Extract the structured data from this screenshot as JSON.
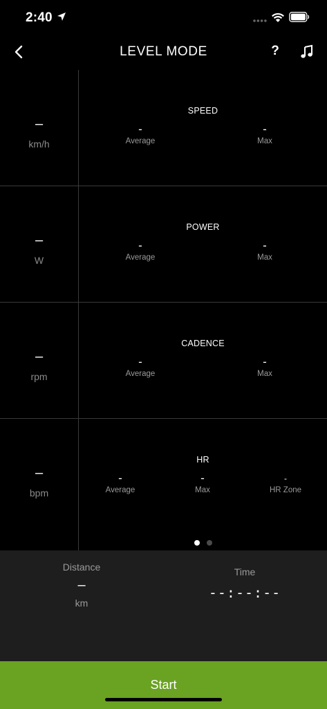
{
  "status_bar": {
    "time": "2:40"
  },
  "nav": {
    "title": "LEVEL MODE",
    "help": "?"
  },
  "metrics": {
    "speed": {
      "current": "–",
      "unit": "km/h",
      "title": "SPEED",
      "avg_value": "-",
      "avg_label": "Average",
      "max_value": "-",
      "max_label": "Max"
    },
    "power": {
      "current": "–",
      "unit": "W",
      "title": "POWER",
      "avg_value": "-",
      "avg_label": "Average",
      "max_value": "-",
      "max_label": "Max"
    },
    "cadence": {
      "current": "–",
      "unit": "rpm",
      "title": "CADENCE",
      "avg_value": "-",
      "avg_label": "Average",
      "max_value": "-",
      "max_label": "Max"
    },
    "hr": {
      "current": "–",
      "unit": "bpm",
      "title": "HR",
      "avg_value": "-",
      "avg_label": "Average",
      "max_value": "-",
      "max_label": "Max",
      "zone_value": "-",
      "zone_label": "HR Zone"
    }
  },
  "pager": {
    "pages": 2,
    "active": 0
  },
  "summary": {
    "distance": {
      "label": "Distance",
      "value": "–",
      "unit": "km"
    },
    "time": {
      "label": "Time",
      "value": "--:--:--"
    }
  },
  "start_button": {
    "label": "Start"
  },
  "colors": {
    "accent": "#6aa222",
    "background": "#000000",
    "panel": "#1e1e1e"
  }
}
